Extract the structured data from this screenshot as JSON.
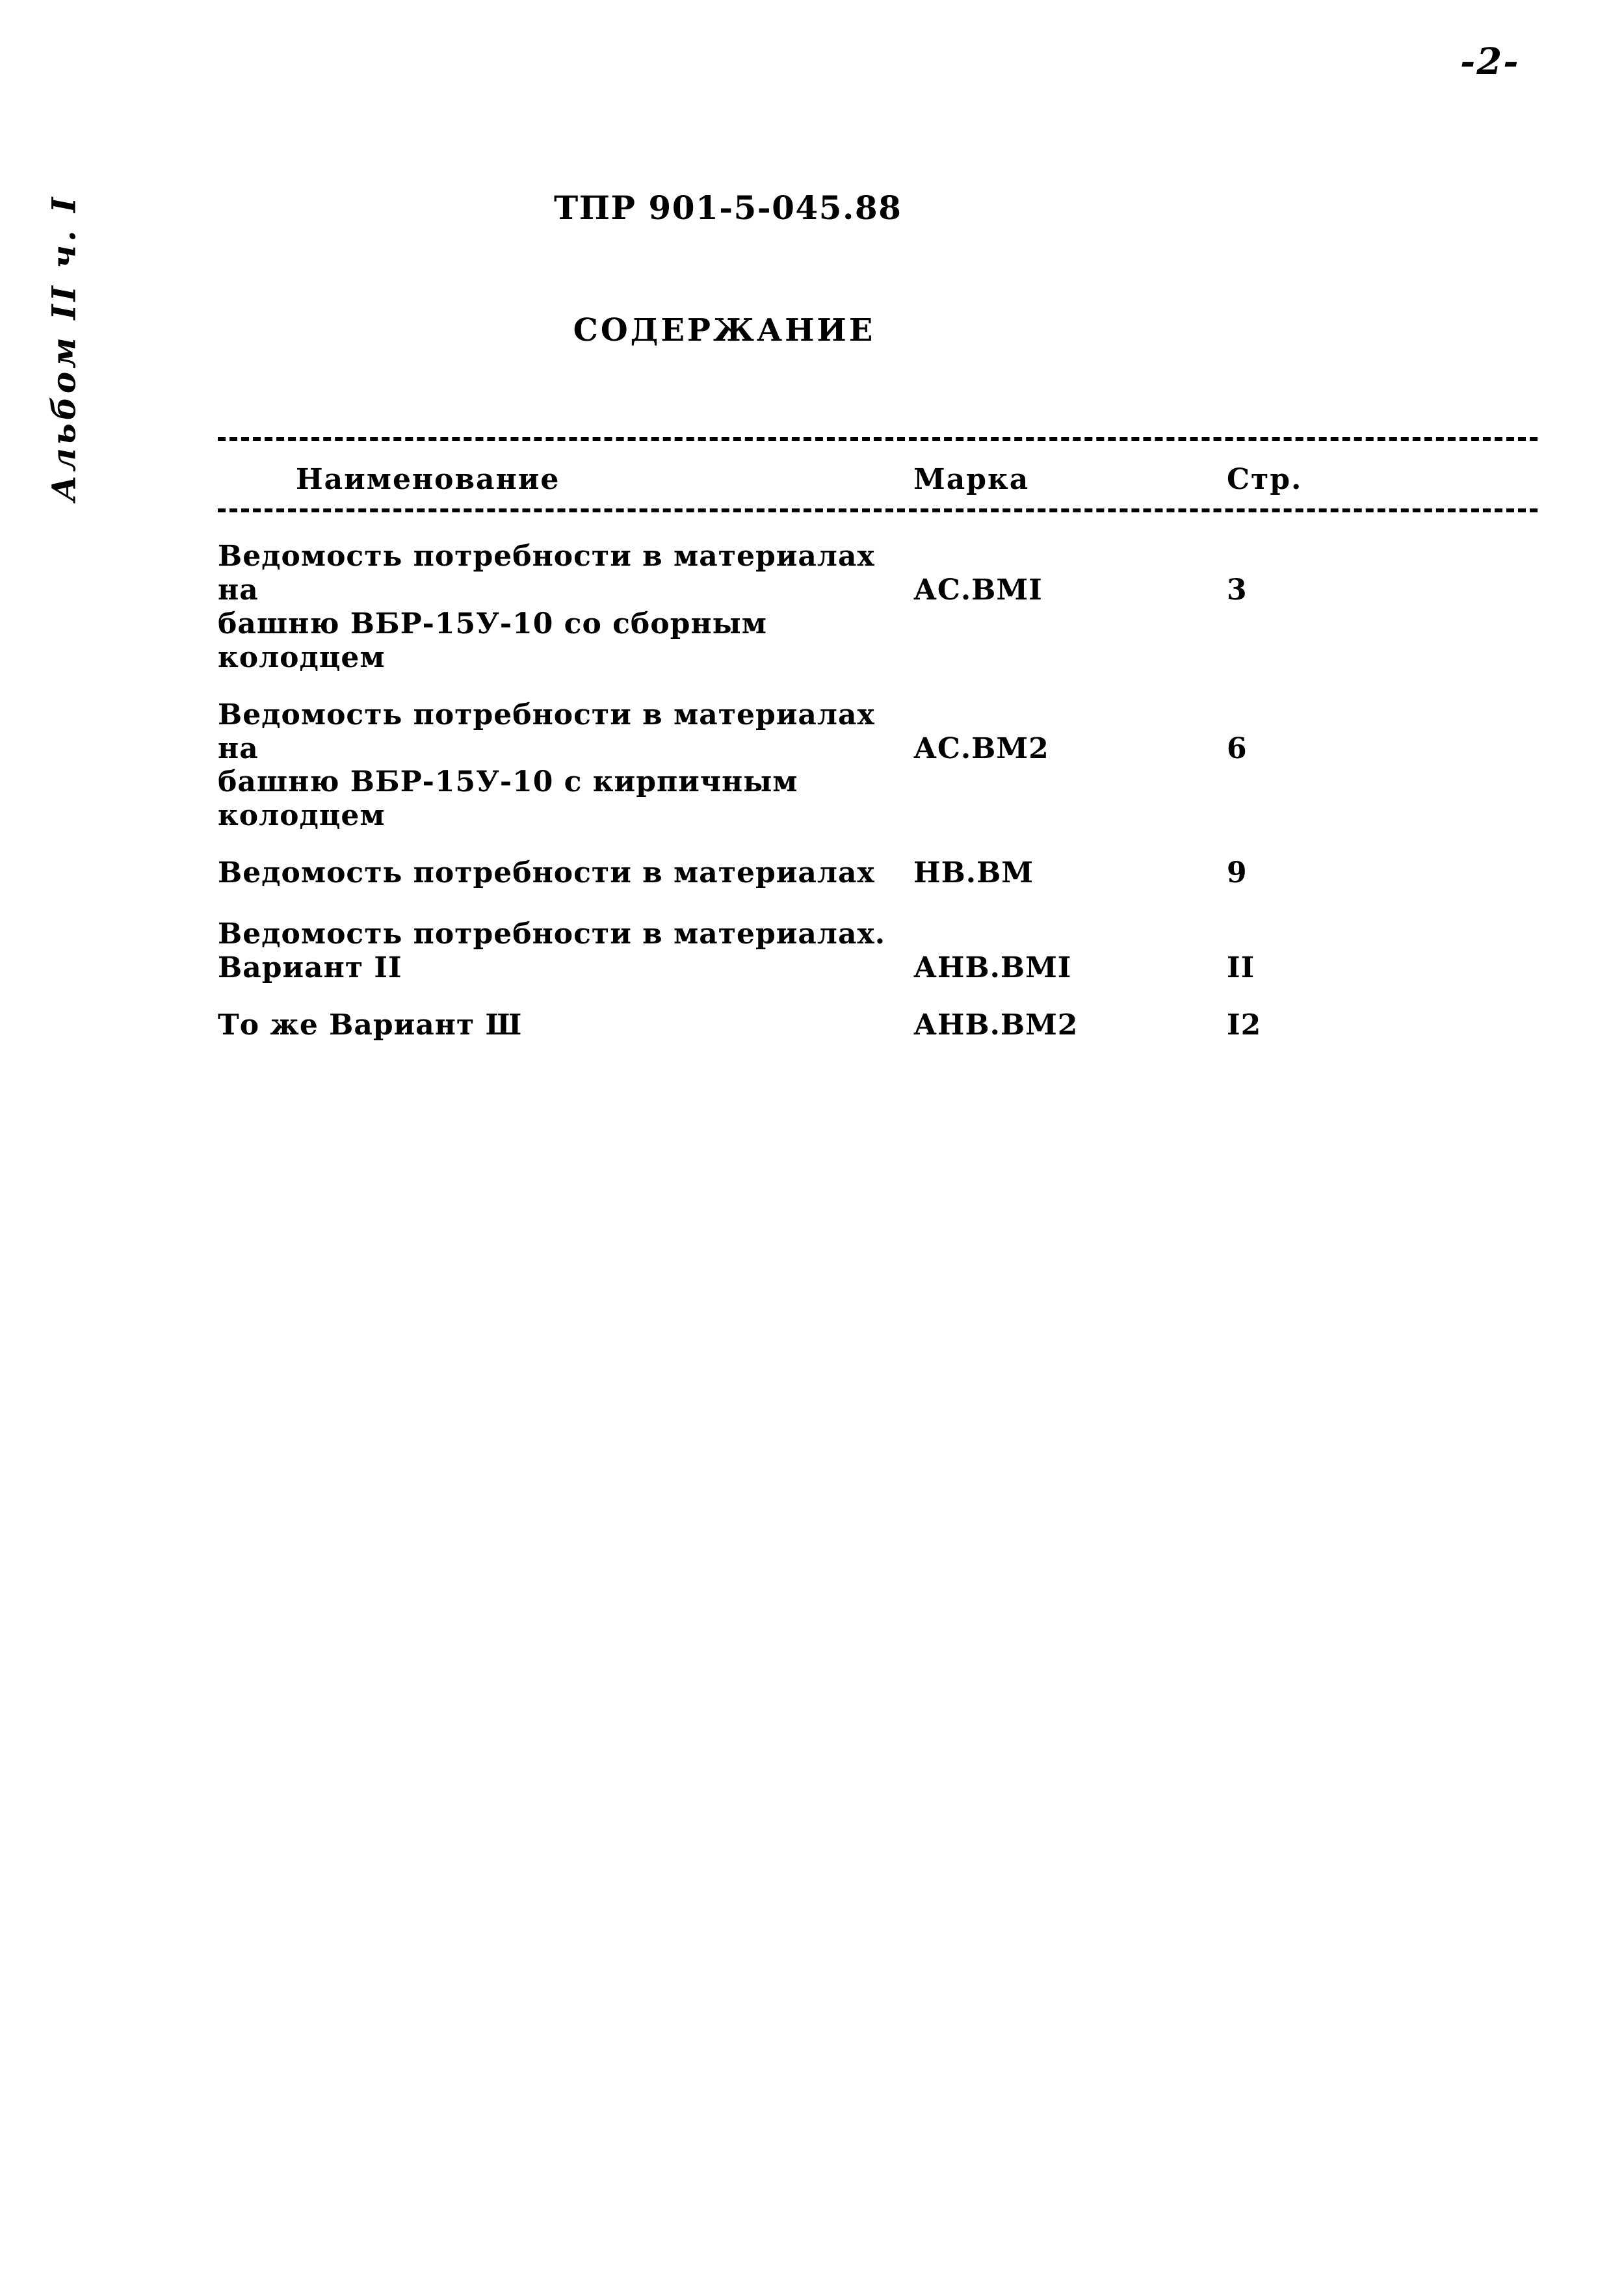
{
  "page": {
    "number_mark": "-2-",
    "album_mark": "Альбом II ч. I",
    "doc_code": "ТПР 901-5-045.88",
    "heading": "СОДЕРЖАНИЕ"
  },
  "toc": {
    "columns": {
      "name": "Наименование",
      "mark": "Марка",
      "page": "Стр."
    },
    "rows": [
      {
        "title_line1": "Ведомость потребности в материалах на",
        "title_line2": "башню ВБР-15У-10 со сборным колодцем",
        "mark": "АС.ВМI",
        "page": "3"
      },
      {
        "title_line1": "Ведомость потребности в материалах на",
        "title_line2": "башню ВБР-15У-10 с кирпичным колодцем",
        "mark": "АС.ВМ2",
        "page": "6"
      },
      {
        "title_line1": "Ведомость потребности в материалах",
        "title_line2": "",
        "mark": "НВ.ВМ",
        "page": "9"
      },
      {
        "title_line1": "Ведомость потребности в материалах.",
        "title_line2": "Вариант II",
        "mark": "АНВ.ВМI",
        "page": "II"
      },
      {
        "title_line1": "То же Вариант Ш",
        "title_line2": "",
        "mark": "АНВ.ВМ2",
        "page": "I2"
      }
    ]
  }
}
